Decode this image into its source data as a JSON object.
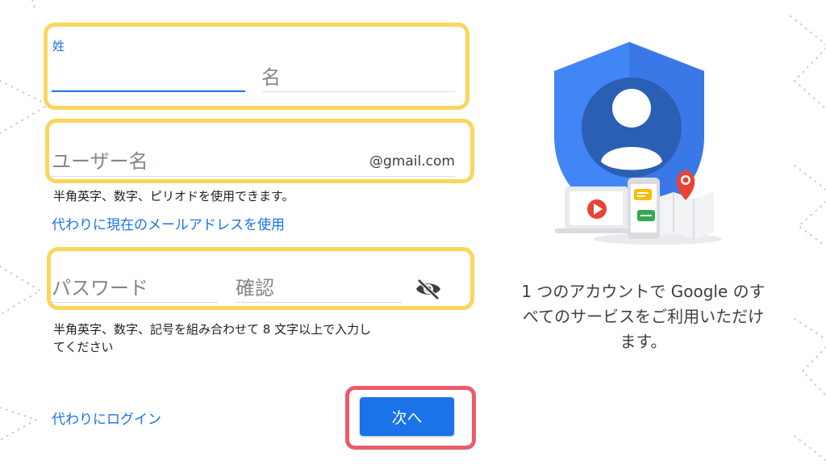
{
  "form": {
    "first_name_label": "姓",
    "last_name_label": "名",
    "username_placeholder": "ユーザー名",
    "username_suffix": "@gmail.com",
    "username_helper": "半角英字、数字、ピリオドを使用できます。",
    "use_existing_email_link": "代わりに現在のメールアドレスを使用",
    "password_placeholder": "パスワード",
    "confirm_placeholder": "確認",
    "password_helper_line1": "半角英字、数字、記号を組み合わせて 8 文字以上で入力し",
    "password_helper_line2": "てください",
    "signin_instead_link": "代わりにログイン",
    "next_button": "次へ",
    "show_password_icon": "eye-off-icon"
  },
  "side": {
    "caption_line1": "1 つのアカウントで Google のす",
    "caption_line2": "べてのサービスをご利用いただけ",
    "caption_line3": "ます。"
  },
  "colors": {
    "accent": "#1a73e8",
    "highlight_yellow": "#f9d65c",
    "highlight_red": "#ea5b6b",
    "shield_blue": "#4285f4"
  }
}
